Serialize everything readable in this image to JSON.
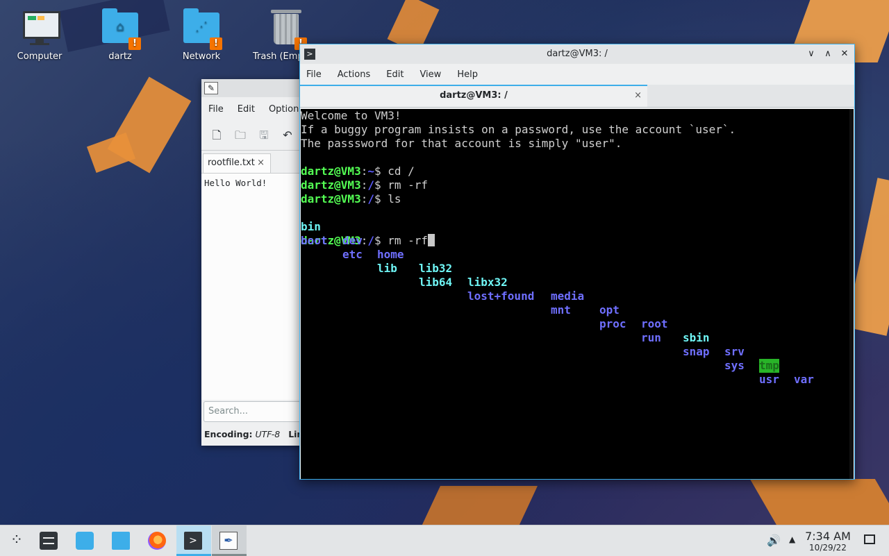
{
  "desktop": {
    "icons": [
      {
        "label": "Computer"
      },
      {
        "label": "dartz",
        "badge": "!"
      },
      {
        "label": "Network",
        "badge": "!"
      },
      {
        "label": "Trash (Emp",
        "badge": "!"
      }
    ]
  },
  "kwrite": {
    "menu": [
      "File",
      "Edit",
      "Options"
    ],
    "tab": {
      "label": "rootfile.txt",
      "close": "×"
    },
    "content": "Hello World!",
    "search": {
      "placeholder": "Search..."
    },
    "status": {
      "encoding_label": "Encoding:",
      "encoding_value": "UTF-8",
      "line_label": "Line"
    }
  },
  "konsole": {
    "title": "dartz@VM3: /",
    "controls": {
      "minimize": "∨",
      "maximize": "∧",
      "close": "✕"
    },
    "menu": [
      "File",
      "Actions",
      "Edit",
      "View",
      "Help"
    ],
    "tab": {
      "label": "dartz@VM3: /",
      "close": "×"
    },
    "motd": [
      "Welcome to VM3!",
      "If a buggy program insists on a password, use the account `user`.",
      "The passsword for that account is simply \"user\"."
    ],
    "prompts": [
      {
        "user": "dartz@VM3",
        "sep": ":",
        "path": "~",
        "sym": "$",
        "cmd": " cd /"
      },
      {
        "user": "dartz@VM3",
        "sep": ":",
        "path": "/",
        "sym": "$",
        "cmd": " rm -rf"
      },
      {
        "user": "dartz@VM3",
        "sep": ":",
        "path": "/",
        "sym": "$",
        "cmd": " ls"
      }
    ],
    "ls_row1": [
      "bin",
      "dev",
      "home",
      "lib32",
      "libx32",
      "media",
      "opt",
      "root",
      "sbin",
      "srv",
      "tmp",
      "var"
    ],
    "ls_row2": [
      "boot",
      "etc",
      "lib",
      "lib64",
      "lost+found",
      "mnt",
      "proc",
      "run",
      "snap",
      "sys",
      "usr"
    ],
    "current": {
      "user": "dartz@VM3",
      "sep": ":",
      "path": "/",
      "sym": "$",
      "cmd": " rm -rf"
    }
  },
  "taskbar": {
    "konsole_glyph": ">",
    "clock_time": "7:34 AM",
    "clock_date": "10/29/22"
  },
  "colors": {
    "accent": "#3daee9",
    "prompt_user": "#54ff54",
    "prompt_path": "#5c5cff",
    "tmp_highlight": "#28b428"
  }
}
